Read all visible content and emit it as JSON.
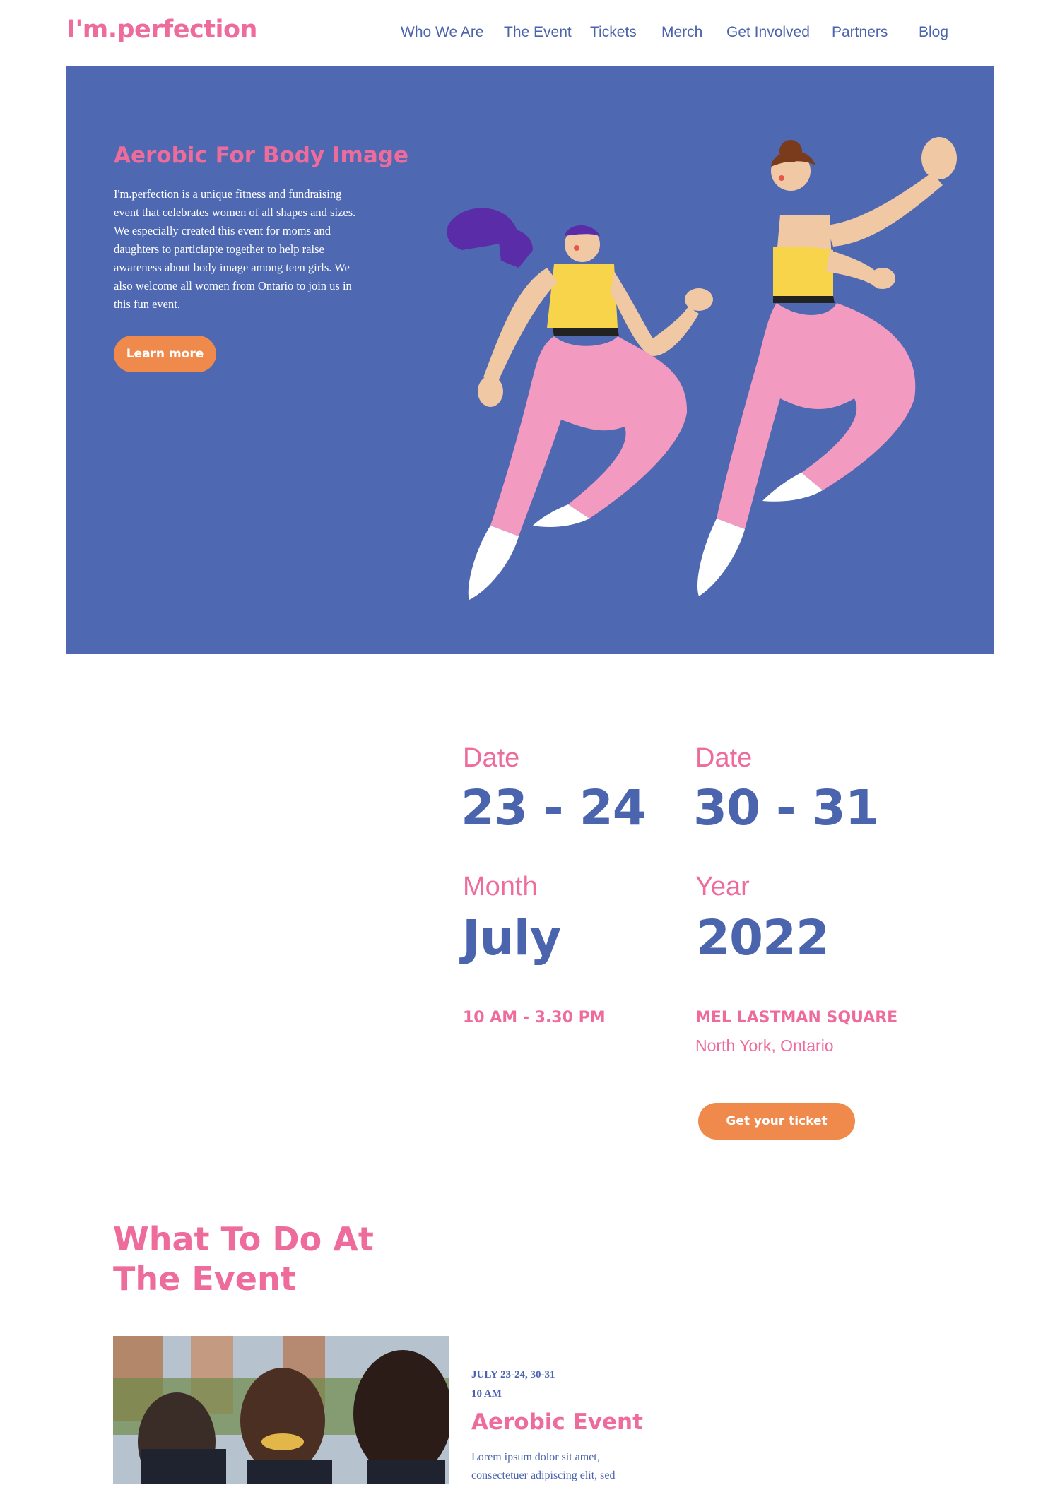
{
  "header": {
    "logo": "I'm.perfection",
    "nav": [
      "Who We Are",
      "The Event",
      "Tickets",
      "Merch",
      "Get Involved",
      "Partners",
      "Blog"
    ]
  },
  "hero": {
    "title": "Aerobic For Body Image",
    "text": "I'm.perfection is a unique fitness and fundraising event that celebrates women of all shapes and sizes. We especially created this event for moms and daughters to particiapte together to help raise awareness about body image among teen girls. We also welcome all women from Ontario to join us in this fun event.",
    "button": "Learn more"
  },
  "details": {
    "date1_label": "Date",
    "date1_value": "23 - 24",
    "date2_label": "Date",
    "date2_value": "30 - 31",
    "month_label": "Month",
    "month_value": "July",
    "year_label": "Year",
    "year_value": "2022",
    "time": "10 AM - 3.30 PM",
    "venue": "MEL LASTMAN SQUARE",
    "city": "North York, Ontario",
    "ticket_button": "Get your ticket"
  },
  "activities": {
    "title": "What To Do At The Event",
    "event": {
      "dates": "JULY 23-24, 30-31",
      "time": "10 AM",
      "title": "Aerobic Event",
      "description": "Lorem ipsum dolor sit amet, consectetuer adipiscing elit, sed"
    }
  },
  "colors": {
    "brand_pink": "#ee6c9c",
    "brand_blue": "#4a64ad",
    "hero_bg": "#4e68b2",
    "button_orange": "#ef8a4c"
  }
}
